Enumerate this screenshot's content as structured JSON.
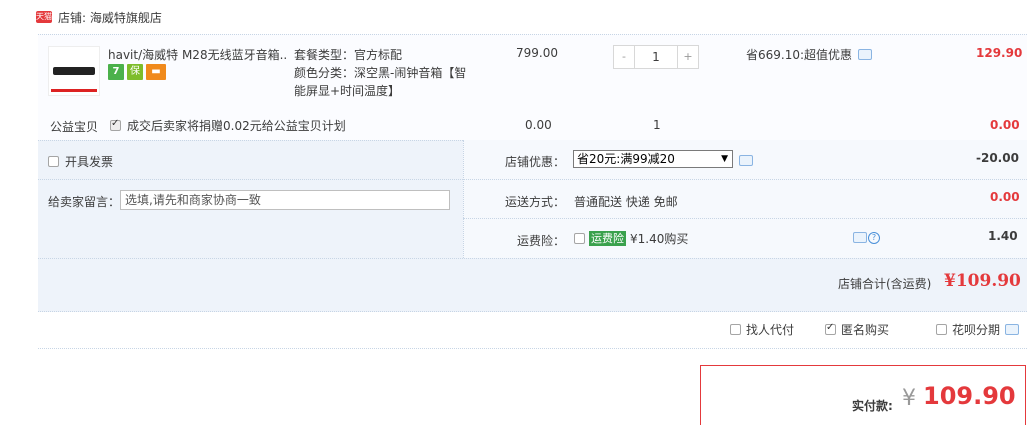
{
  "shop": {
    "badge": "天猫",
    "label": "店铺: 海威特旗舰店"
  },
  "item": {
    "title": "havit/海威特 M28无线蓝牙音箱...",
    "service_icons": [
      "seven-day-return-icon",
      "guarantee-icon",
      "credit-card-icon"
    ],
    "sku_lines": [
      "套餐类型：官方标配",
      "颜色分类：深空黑-闹钟音箱【智",
      "能屏显+时间温度】"
    ],
    "price": "799.00",
    "quantity": "1",
    "qty_minus": "-",
    "qty_plus": "+",
    "discount": "省669.10:超值优惠",
    "subtotal": "129.90"
  },
  "charity": {
    "label": "公益宝贝",
    "text": "成交后卖家将捐赠0.02元给公益宝贝计划",
    "price": "0.00",
    "quantity": "1",
    "subtotal": "0.00"
  },
  "invoice": {
    "label": "开具发票"
  },
  "message": {
    "label": "给卖家留言：",
    "placeholder": "选填,请先和商家协商一致"
  },
  "shop_discount": {
    "label": "店铺优惠：",
    "selected": "省20元:满99减20",
    "amount": "-20.00"
  },
  "shipping": {
    "label": "运送方式：",
    "value": "普通配送 快递 免邮",
    "amount": "0.00"
  },
  "insurance": {
    "label": "运费险：",
    "tag": "运费险",
    "text": "¥1.40购买",
    "amount": "1.40"
  },
  "shop_total": {
    "label": "店铺合计(含运费)",
    "amount": "¥109.90"
  },
  "options": {
    "pay_for_me": "找人代付",
    "anonymous": "匿名购买",
    "installment": "花呗分期"
  },
  "payment": {
    "label": "实付款:",
    "currency": "¥",
    "amount": "109.90"
  },
  "colors": {
    "accent_red": "#e4393c",
    "panel_blue": "#eef3fa",
    "green_tag": "#3aa14d"
  }
}
